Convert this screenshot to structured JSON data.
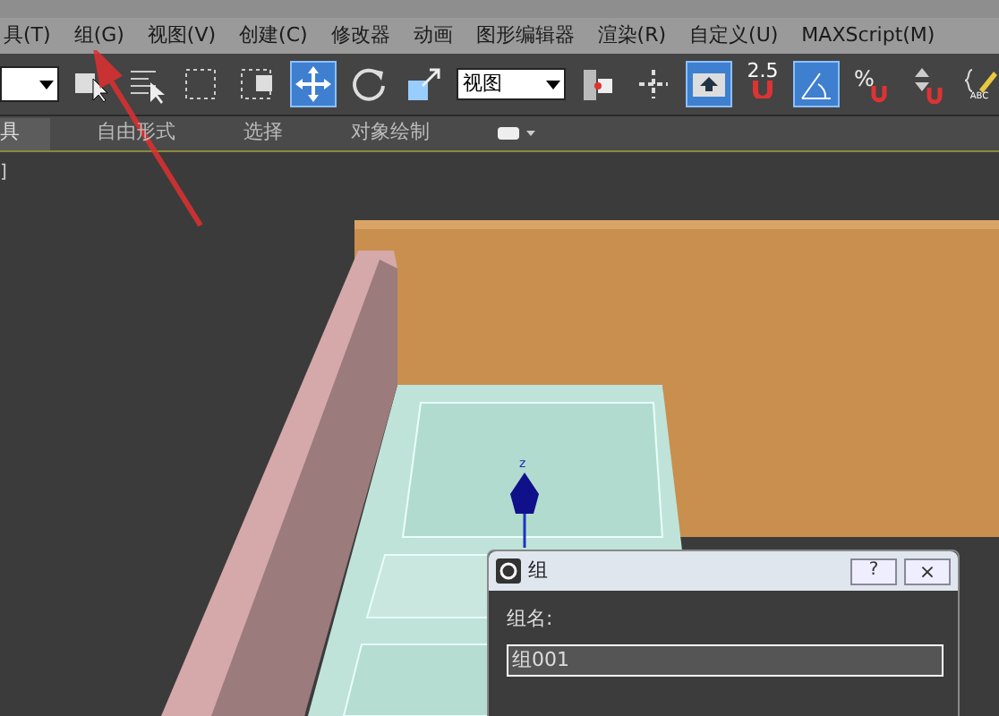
{
  "menu_bar": {
    "items": [
      {
        "label": "具(T)",
        "selected": false
      },
      {
        "label": "组(G)",
        "selected": false
      },
      {
        "label": "视图(V)",
        "selected": false
      },
      {
        "label": "创建(C)",
        "selected": false
      },
      {
        "label": "修改器",
        "selected": false
      },
      {
        "label": "动画",
        "selected": false
      },
      {
        "label": "图形编辑器",
        "selected": false
      },
      {
        "label": "渲染(R)",
        "selected": false
      },
      {
        "label": "自定义(U)",
        "selected": false
      },
      {
        "label": "MAXScript(M)",
        "selected": false
      }
    ]
  },
  "toolbar": {
    "view_dropdown": "视图",
    "snap_value": "2.5",
    "snap_label": "ABC",
    "percent_symbol": "%"
  },
  "ribbon": {
    "tabs": [
      {
        "label": "具",
        "selected": true
      },
      {
        "label": "自由形式",
        "selected": false
      },
      {
        "label": "选择",
        "selected": false
      },
      {
        "label": "对象绘制",
        "selected": false
      }
    ]
  },
  "viewport": {
    "label": "]",
    "gizmo_axis": "z"
  },
  "dialog": {
    "title": "组",
    "help_button": "?",
    "close_button": "×",
    "field_label": "组名:",
    "field_value": "组001"
  }
}
